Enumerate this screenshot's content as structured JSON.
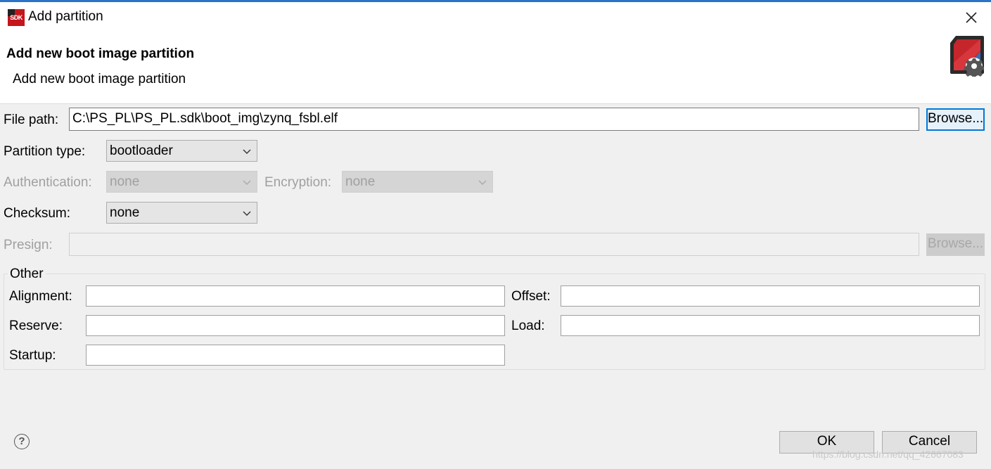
{
  "window": {
    "title": "Add partition",
    "app_icon_text": "SDK",
    "close_icon": "close-icon"
  },
  "banner": {
    "title": "Add new boot image partition",
    "description": "Add new boot image partition",
    "image_icon": "sd-card-gear-icon"
  },
  "form": {
    "file_path_label": "File path:",
    "file_path_value": "C:\\PS_PL\\PS_PL.sdk\\boot_img\\zynq_fsbl.elf",
    "browse_label": "Browse...",
    "partition_type_label": "Partition type:",
    "partition_type_value": "bootloader",
    "authentication_label": "Authentication:",
    "authentication_value": "none",
    "encryption_label": "Encryption:",
    "encryption_value": "none",
    "checksum_label": "Checksum:",
    "checksum_value": "none",
    "presign_label": "Presign:",
    "presign_value": "",
    "presign_browse_label": "Browse..."
  },
  "other": {
    "title": "Other",
    "alignment_label": "Alignment:",
    "alignment_value": "",
    "offset_label": "Offset:",
    "offset_value": "",
    "reserve_label": "Reserve:",
    "reserve_value": "",
    "load_label": "Load:",
    "load_value": "",
    "startup_label": "Startup:",
    "startup_value": ""
  },
  "footer": {
    "help_symbol": "?",
    "ok_label": "OK",
    "cancel_label": "Cancel"
  },
  "watermark": "https://blog.csdn.net/qq_42667083",
  "colors": {
    "accent": "#0078d7",
    "window_bg": "#f0f0f0",
    "banner_bg": "#ffffff",
    "brand_red": "#c4161c"
  }
}
